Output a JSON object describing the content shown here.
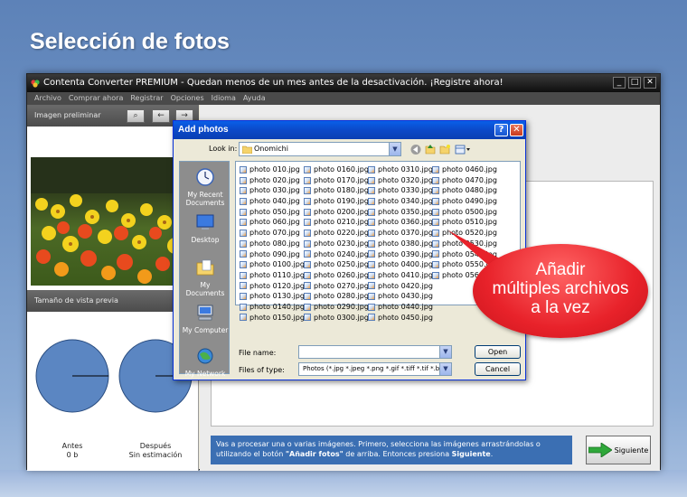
{
  "banner": {
    "title": "Selección de fotos"
  },
  "app": {
    "title": "Contenta Converter PREMIUM  - Quedan menos de un mes antes de la desactivación. ¡Registre ahora!",
    "window_buttons": [
      "_",
      "□",
      "✕"
    ],
    "menu": [
      "Archivo",
      "Comprar ahora",
      "Registrar",
      "Opciones",
      "Idioma",
      "Ayuda"
    ],
    "preview_header": "Imagen preliminar",
    "preview_size_header": "Tamaño de vista previa",
    "before_label": "Antes",
    "before_value": "0 b",
    "after_label": "Después",
    "after_value": "Sin estimación",
    "info_text_1": "Vas a procesar una o varias imágenes. Primero, selecciona las imágenes arrastrándolas o utilizando el botón ",
    "info_bold_1": "\"Añadir fotos\"",
    "info_text_2": " de arriba. Entonces presiona ",
    "info_bold_2": "Siguiente",
    "info_text_3": ".",
    "next_label": "Siguiente",
    "colors": {
      "accent": "#3b6fb3",
      "pie": "#5b86c2",
      "callout": "#e8222a"
    }
  },
  "dialog": {
    "title": "Add photos",
    "help_btn": "?",
    "close_btn": "✕",
    "look_in_label": "Look in:",
    "look_in_value": "Onomichi",
    "places": [
      "My Recent Documents",
      "Desktop",
      "My Documents",
      "My Computer",
      "My Network"
    ],
    "files": [
      [
        "photo 010.jpg",
        "photo 020.jpg",
        "photo 030.jpg",
        "photo 040.jpg",
        "photo 050.jpg",
        "photo 060.jpg",
        "photo 070.jpg",
        "photo 080.jpg",
        "photo 090.jpg",
        "photo 0100.jpg",
        "photo 0110.jpg",
        "photo 0120.jpg",
        "photo 0130.jpg",
        "photo 0140.jpg",
        "photo 0150.jpg"
      ],
      [
        "photo 0160.jpg",
        "photo 0170.jpg",
        "photo 0180.jpg",
        "photo 0190.jpg",
        "photo 0200.jpg",
        "photo 0210.jpg",
        "photo 0220.jpg",
        "photo 0230.jpg",
        "photo 0240.jpg",
        "photo 0250.jpg",
        "photo 0260.jpg",
        "photo 0270.jpg",
        "photo 0280.jpg",
        "photo 0290.jpg",
        "photo 0300.jpg"
      ],
      [
        "photo 0310.jpg",
        "photo 0320.jpg",
        "photo 0330.jpg",
        "photo 0340.jpg",
        "photo 0350.jpg",
        "photo 0360.jpg",
        "photo 0370.jpg",
        "photo 0380.jpg",
        "photo 0390.jpg",
        "photo 0400.jpg",
        "photo 0410.jpg",
        "photo 0420.jpg",
        "photo 0430.jpg",
        "photo 0440.jpg",
        "photo 0450.jpg"
      ],
      [
        "photo 0460.jpg",
        "photo 0470.jpg",
        "photo 0480.jpg",
        "photo 0490.jpg",
        "photo 0500.jpg",
        "photo 0510.jpg",
        "photo 0520.jpg",
        "photo 0530.jpg",
        "photo 0540.jpg",
        "photo 0550.jpg",
        "photo 0560.jpg"
      ]
    ],
    "file_name_label": "File name:",
    "file_name_value": "",
    "files_of_type_label": "Files of type:",
    "files_of_type_value": "Photos (*.jpg *.jpeg *.png *.gif *.tiff *.tif *.bmp *.jp",
    "open_label": "Open",
    "cancel_label": "Cancel"
  },
  "callout": {
    "line1": "Añadir",
    "line2": "múltiples archivos",
    "line3": "a la vez"
  }
}
